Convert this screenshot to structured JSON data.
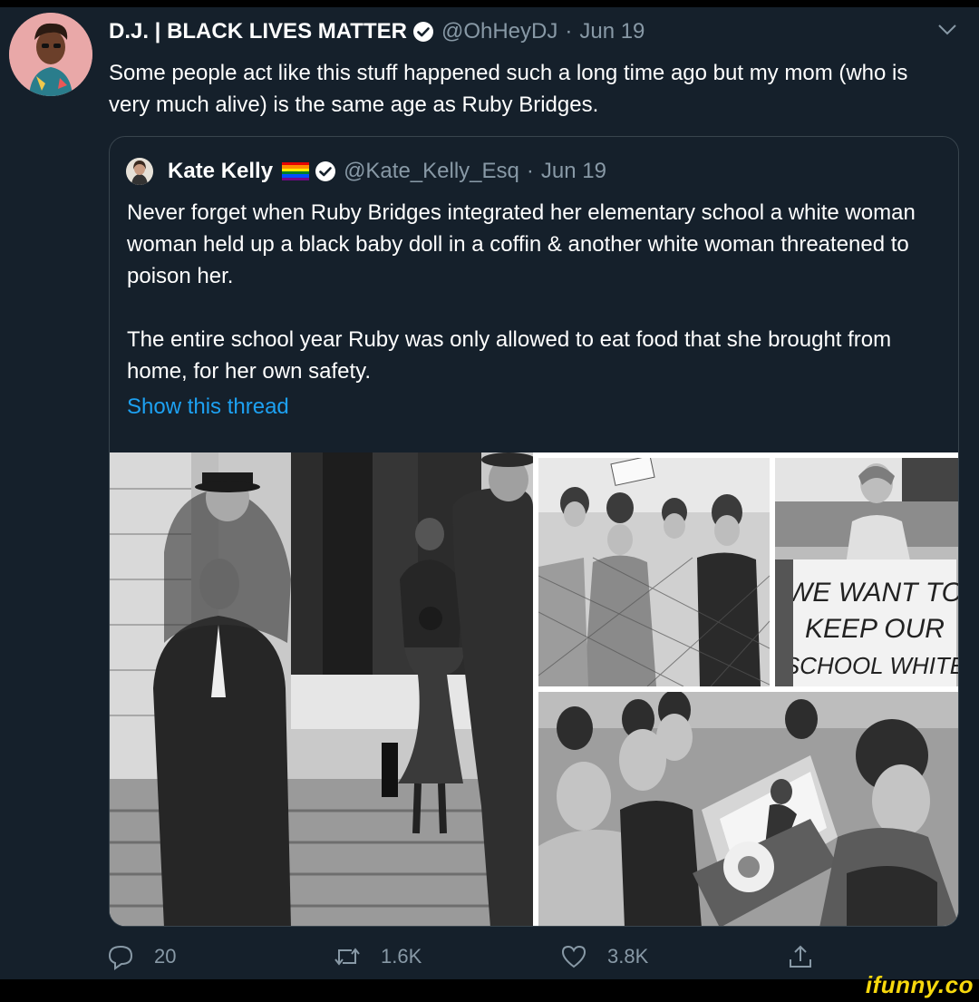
{
  "tweet": {
    "display_name": "D.J. | BLACK LIVES MATTER",
    "handle": "@OhHeyDJ",
    "separator": "·",
    "date": "Jun 19",
    "text": "Some people act like this stuff happened such a long time ago but my mom (who is very much alive) is the same age as Ruby Bridges."
  },
  "quote": {
    "display_name": "Kate Kelly",
    "handle": "@Kate_Kelly_Esq",
    "separator": "·",
    "date": "Jun 19",
    "paragraph1": "Never forget when Ruby Bridges integrated her elementary school a white woman woman held up a black baby doll in a coffin & another white woman threatened to poison her.",
    "paragraph2": "The entire school year Ruby was  only allowed to eat food that she brought from home, for her own safety.",
    "show_thread": "Show this thread",
    "sign_text": [
      "WE WANT TO",
      "KEEP OUR",
      "SCHOOL WHITE"
    ]
  },
  "actions": {
    "replies": "20",
    "retweets": "1.6K",
    "likes": "3.8K"
  },
  "watermark": "ifunny.co",
  "colors": {
    "background": "#15202b",
    "accent": "#1da1f2",
    "muted": "#8899a6",
    "border": "#38444d"
  },
  "icons": [
    "verified-badge-icon",
    "chevron-down-icon",
    "rainbow-flag-icon",
    "reply-icon",
    "retweet-icon",
    "like-icon",
    "share-icon"
  ]
}
